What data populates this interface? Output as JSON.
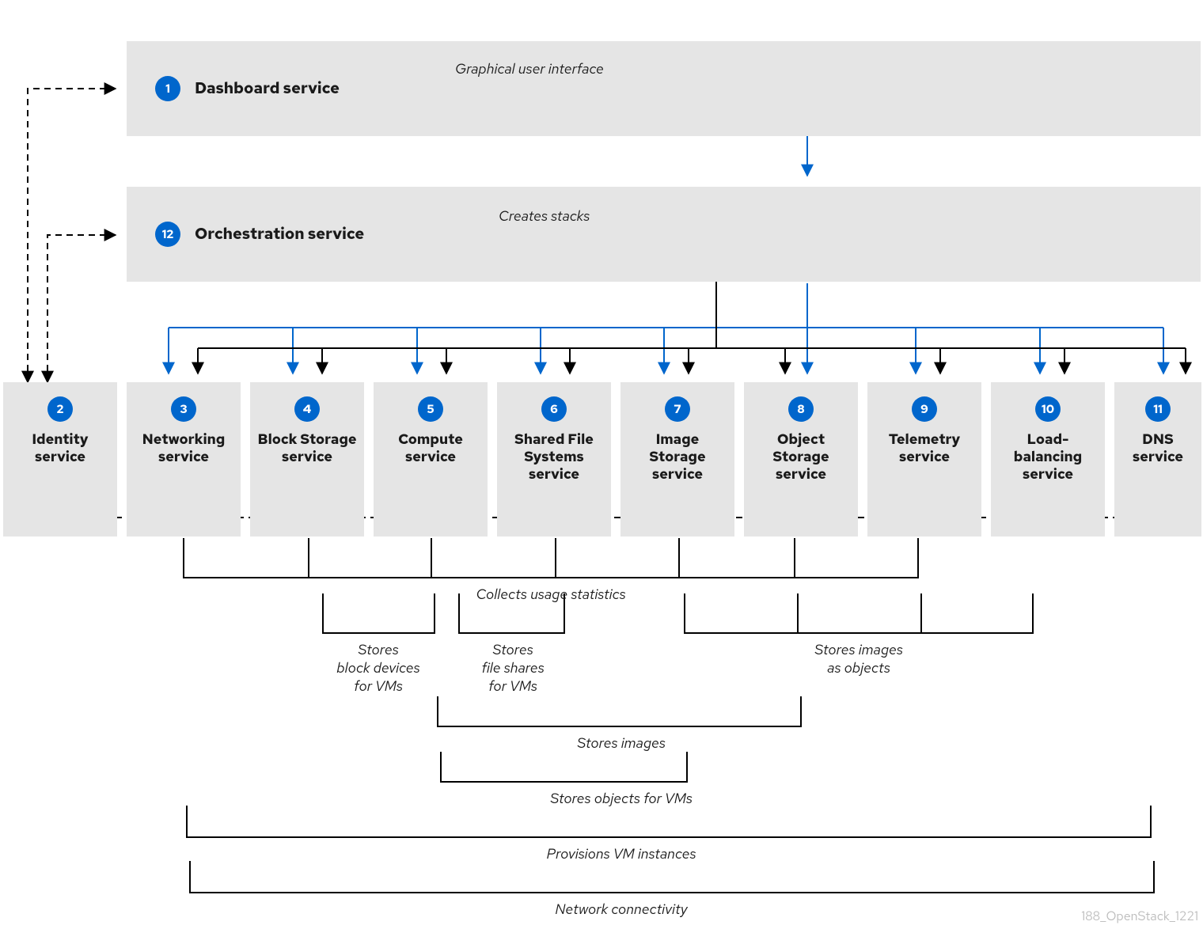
{
  "panels": {
    "dashboard": {
      "num": "1",
      "title": "Dashboard service"
    },
    "orchestration": {
      "num": "12",
      "title": "Orchestration service"
    }
  },
  "cards": [
    {
      "num": "2",
      "label": "Identity service"
    },
    {
      "num": "3",
      "label": "Networking service"
    },
    {
      "num": "4",
      "label": "Block Storage service"
    },
    {
      "num": "5",
      "label": "Compute service"
    },
    {
      "num": "6",
      "label": "Shared File Systems service"
    },
    {
      "num": "7",
      "label": "Image Storage service"
    },
    {
      "num": "8",
      "label": "Object Storage service"
    },
    {
      "num": "9",
      "label": "Telemetry service"
    },
    {
      "num": "10",
      "label": "Load-balancing service"
    },
    {
      "num": "11",
      "label": "DNS service"
    }
  ],
  "notes": {
    "gui": "Graphical user interface",
    "creates": "Creates stacks",
    "collects": "Collects usage statistics",
    "blockdev": "Stores\nblock devices\nfor VMs",
    "fileshares": "Stores\nfile shares\nfor VMs",
    "imgobj": "Stores images\nas objects",
    "storesimg": "Stores images",
    "storesobj": "Stores objects for VMs",
    "prov": "Provisions VM instances",
    "net": "Network connectivity"
  },
  "watermark": "188_OpenStack_1221"
}
